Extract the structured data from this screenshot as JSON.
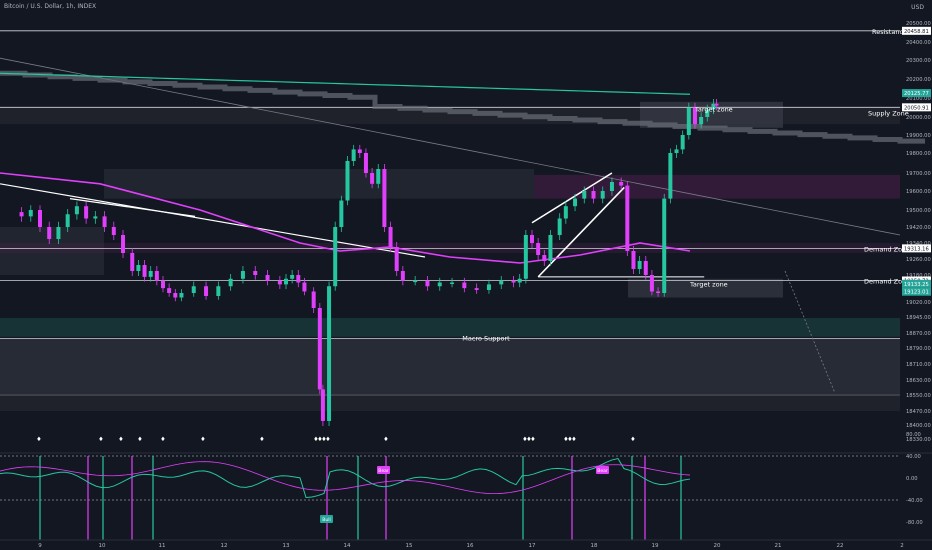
{
  "header": {
    "symbol_title": "Bitcoin / U.S. Dollar, 1h, INDEX",
    "currency": "USD"
  },
  "price_axis": {
    "ticks": [
      "20500.00",
      "20400.00",
      "20300.00",
      "20200.00",
      "20100.00",
      "20000.00",
      "19900.00",
      "19800.00",
      "19700.00",
      "19600.00",
      "19500.00",
      "19420.00",
      "19340.00",
      "19260.00",
      "19180.00",
      "19100.00",
      "19020.00",
      "18945.00",
      "18870.00",
      "18790.00",
      "18710.00",
      "18630.00",
      "18550.00",
      "18470.00",
      "18400.00",
      "18330.00"
    ],
    "badges": [
      {
        "label": "20458.81",
        "price": 20458.81,
        "style": "white"
      },
      {
        "label": "20125.77",
        "price": 20125.77,
        "style": "green"
      },
      {
        "label": "20050.91",
        "price": 20050.91,
        "style": "white"
      },
      {
        "label": "19313.16",
        "price": 19313.16,
        "style": "white"
      },
      {
        "label": "19150.71",
        "price": 19150.71,
        "style": "white"
      },
      {
        "label": "19133.25",
        "price": 19133.25,
        "style": "green"
      },
      {
        "label": "19123.01",
        "price": 19123.01,
        "style": "green"
      }
    ]
  },
  "time_axis": {
    "ticks": [
      "9",
      "10",
      "11",
      "12",
      "13",
      "14",
      "15",
      "16",
      "17",
      "18",
      "19",
      "20",
      "21",
      "22",
      "2"
    ]
  },
  "annotations": {
    "resistance": "Resistance",
    "supply_zone": "Supply Zone",
    "demand_zone_1": "Demand Zone",
    "demand_zone_2": "Demand Zone",
    "target_zone_1": "Target zone",
    "target_zone_2": "Target zone",
    "macro_support": "Macro Support"
  },
  "oscillator": {
    "ticks": [
      "80.00",
      "40.00",
      "0.00",
      "-40.00",
      "-80.00"
    ],
    "labels": {
      "bear_1": "Bear",
      "bear_2": "Bear",
      "bull": "Bull"
    }
  },
  "chart_data": {
    "type": "candlestick",
    "title": "Bitcoin / U.S. Dollar, 1h, INDEX",
    "ylabel": "USD",
    "ylim": [
      18300,
      20560
    ],
    "x_range_days": [
      8.5,
      22.5
    ],
    "levels": {
      "resistance": 20458.81,
      "supply_zone": 20050.91,
      "demand_zone_1": 19313.16,
      "demand_zone_2": 19150.71,
      "macro_support": 18840
    },
    "close_series": [
      [
        8.55,
        19490
      ],
      [
        8.7,
        19470
      ],
      [
        8.85,
        19500
      ],
      [
        9.0,
        19420
      ],
      [
        9.15,
        19360
      ],
      [
        9.3,
        19420
      ],
      [
        9.45,
        19480
      ],
      [
        9.6,
        19520
      ],
      [
        9.75,
        19460
      ],
      [
        9.9,
        19470
      ],
      [
        10.05,
        19420
      ],
      [
        10.2,
        19380
      ],
      [
        10.35,
        19290
      ],
      [
        10.5,
        19200
      ],
      [
        10.6,
        19230
      ],
      [
        10.7,
        19170
      ],
      [
        10.8,
        19200
      ],
      [
        10.9,
        19150
      ],
      [
        11.0,
        19110
      ],
      [
        11.1,
        19080
      ],
      [
        11.2,
        19050
      ],
      [
        11.3,
        19080
      ],
      [
        11.5,
        19120
      ],
      [
        11.7,
        19060
      ],
      [
        11.9,
        19120
      ],
      [
        12.1,
        19160
      ],
      [
        12.3,
        19200
      ],
      [
        12.5,
        19180
      ],
      [
        12.7,
        19150
      ],
      [
        12.9,
        19130
      ],
      [
        13.0,
        19160
      ],
      [
        13.1,
        19180
      ],
      [
        13.2,
        19140
      ],
      [
        13.3,
        19090
      ],
      [
        13.45,
        18990
      ],
      [
        13.55,
        18580
      ],
      [
        13.6,
        18420
      ],
      [
        13.7,
        19120
      ],
      [
        13.8,
        19420
      ],
      [
        13.9,
        19550
      ],
      [
        14.0,
        19760
      ],
      [
        14.1,
        19820
      ],
      [
        14.2,
        19800
      ],
      [
        14.3,
        19700
      ],
      [
        14.4,
        19640
      ],
      [
        14.5,
        19720
      ],
      [
        14.6,
        19420
      ],
      [
        14.7,
        19320
      ],
      [
        14.8,
        19200
      ],
      [
        14.9,
        19150
      ],
      [
        15.1,
        19150
      ],
      [
        15.3,
        19120
      ],
      [
        15.5,
        19140
      ],
      [
        15.7,
        19140
      ],
      [
        15.9,
        19110
      ],
      [
        16.1,
        19100
      ],
      [
        16.3,
        19130
      ],
      [
        16.5,
        19150
      ],
      [
        16.7,
        19140
      ],
      [
        16.8,
        19160
      ],
      [
        16.9,
        19380
      ],
      [
        17.0,
        19340
      ],
      [
        17.1,
        19280
      ],
      [
        17.2,
        19250
      ],
      [
        17.3,
        19380
      ],
      [
        17.45,
        19460
      ],
      [
        17.55,
        19520
      ],
      [
        17.7,
        19560
      ],
      [
        17.85,
        19600
      ],
      [
        18.0,
        19560
      ],
      [
        18.15,
        19600
      ],
      [
        18.3,
        19650
      ],
      [
        18.45,
        19630
      ],
      [
        18.55,
        19300
      ],
      [
        18.65,
        19210
      ],
      [
        18.75,
        19250
      ],
      [
        18.85,
        19180
      ],
      [
        18.95,
        19090
      ],
      [
        19.05,
        19080
      ],
      [
        19.15,
        19560
      ],
      [
        19.25,
        19800
      ],
      [
        19.35,
        19820
      ],
      [
        19.45,
        19900
      ],
      [
        19.55,
        20050
      ],
      [
        19.65,
        19960
      ],
      [
        19.75,
        20000
      ],
      [
        19.85,
        20040
      ],
      [
        19.95,
        20070
      ],
      [
        20.0,
        20060
      ]
    ]
  }
}
